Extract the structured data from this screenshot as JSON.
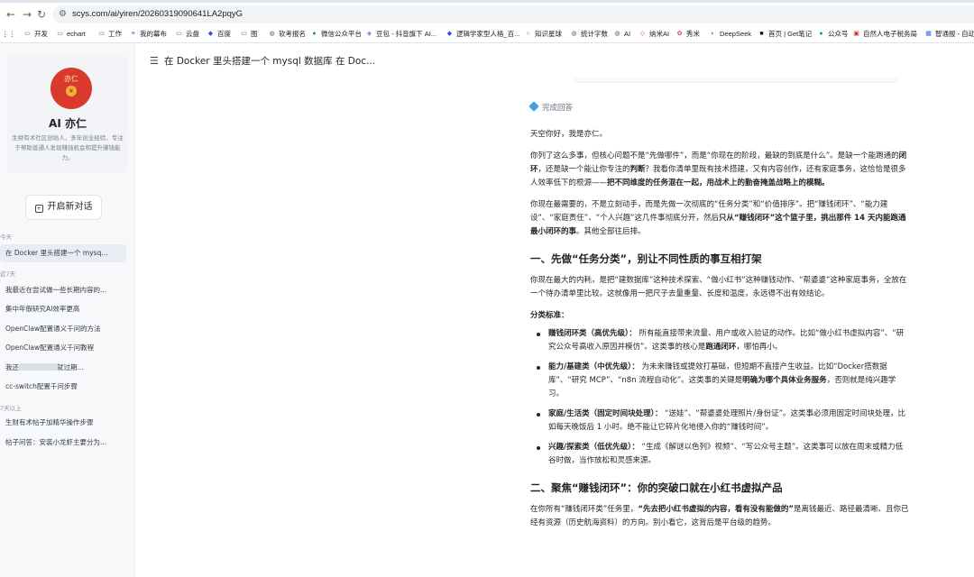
{
  "browser": {
    "url": "scys.com/ai/yiren/20260319090641LA2pqyG",
    "bookmarks": [
      {
        "label": "开发",
        "icon": "folder-icon"
      },
      {
        "label": "echart",
        "icon": "folder-icon"
      },
      {
        "label": "工作",
        "icon": "folder-icon"
      },
      {
        "label": "我的幕布",
        "icon": "mubu-icon"
      },
      {
        "label": "云盘",
        "icon": "folder-icon"
      },
      {
        "label": "百度",
        "icon": "baidu-icon"
      },
      {
        "label": "图",
        "icon": "folder-icon"
      },
      {
        "label": "软考报名",
        "icon": "globe-icon"
      },
      {
        "label": "微信公众平台",
        "icon": "wechat-icon"
      },
      {
        "label": "豆包 - 抖音旗下 AI...",
        "icon": "doubao-icon"
      },
      {
        "label": "逻辑学家型人格_百...",
        "icon": "baidu-icon"
      },
      {
        "label": "知识星球",
        "icon": "zsxq-icon"
      },
      {
        "label": "统计字数",
        "icon": "globe-icon"
      },
      {
        "label": "AI",
        "icon": "globe-icon"
      },
      {
        "label": "纳米AI",
        "icon": "nami-icon"
      },
      {
        "label": "秀米",
        "icon": "xiumi-icon"
      },
      {
        "label": "DeepSeek",
        "icon": "deepseek-icon"
      },
      {
        "label": "首页 | Get笔记",
        "icon": "getnote-icon"
      },
      {
        "label": "公众号",
        "icon": "wechat-icon"
      },
      {
        "label": "自然人电子税务局",
        "icon": "tax-icon"
      },
      {
        "label": "智通报 - 自动发",
        "icon": "doc-icon"
      }
    ]
  },
  "sidebar": {
    "profile": {
      "avatar_text": "亦仁",
      "avatar_coin": "¥",
      "name": "AI 亦仁",
      "description": "生财有术社区创始人，多年创业经验，专注于帮助普通人发现赚钱机会和提升赚钱能力。"
    },
    "new_chat_label": "开启新对话",
    "groups": {
      "today": "今天",
      "last7": "近7天",
      "last30": "7天以上"
    },
    "history": {
      "today": [
        "在 Docker 里头搭建一个 mysq..."
      ],
      "last7": [
        "我最近在尝试做一些长期内容的...",
        "集中年假研究AI效率更高",
        "OpenClaw配置通义千问的方法",
        "OpenClaw配置通义千问教程",
        "cc-switch配置千问步骤"
      ],
      "blurred_item_prefix": "我还",
      "blurred_item_suffix": "就过期...",
      "last30": [
        "生财有术帖子加精华操作步骤",
        "帖子问答：安装小龙虾主要分为..."
      ]
    }
  },
  "main": {
    "title": "在 Docker 里头搭建一个 mysql 数据库 在 Doc...",
    "status": "完成回答",
    "greeting": "天空你好，我是亦仁。",
    "p1": [
      "你列了这么多事，但核心问题不是“先做哪件”，而是“你现在的阶段，最缺的到底是什么”。是缺一个能跑通的",
      "闭环",
      "，还是缺一个能让你专注的",
      "判断",
      "？我看你清单里既有技术搭建，又有内容创作，还有家庭事务，这恰恰是很多人效率低下的根源——",
      "把不同维度的任务混在一起，用战术上的勤奋掩盖战略上的模糊。"
    ],
    "p2": [
      "你现在最需要的，不是立刻动手，而是先做一次彻底的“任务分类”和“价值排序”。把“赚钱闭环”、“能力建设”、“家庭责任”、“个人兴趣”这几件事彻底分开，然后",
      "只从“赚钱闭环”这个篮子里，挑出那件 14 天内能跑通最小闭环的事",
      "。其他全部往后排。"
    ],
    "h1": "一、先做“任务分类”，别让不同性质的事互相打架",
    "p3": "你现在最大的内耗，是把“建数据库”这种技术探索、“做小红书”这种赚钱动作、“帮婆婆”这种家庭事务，全放在一个待办清单里比较。这就像用一把尺子去量重量、长度和温度，永远得不出有效结论。",
    "sub": "分类标准：",
    "bullets": [
      {
        "head": "赚钱闭环类（高优先级）：",
        "text": " 所有能直接带来流量、用户或收入验证的动作。比如“做小红书虚拟内容”、“研究公众号高收入原因并模仿”。这类事的核心是",
        "bold2": "跑通闭环",
        "tail": "，哪怕再小。"
      },
      {
        "head": "能力/基建类（中优先级）：",
        "text": " 为未来赚钱或提效打基础，但短期不直接产生收益。比如“Docker搭数据库”、“研究 MCP”、“n8n 流程自动化”。这类事的关键是",
        "bold2": "明确为哪个具体业务服务",
        "tail": "，否则就是纯兴趣学习。"
      },
      {
        "head": "家庭/生活类（固定时间块处理）：",
        "text": " “送娃”、“帮婆婆处理照片/身份证”。这类事必须用固定时间块处理，比如每天晚饭后 1 小时。绝不能让它碎片化地侵入你的“赚钱时间”。",
        "bold2": "",
        "tail": ""
      },
      {
        "head": "兴趣/探索类（低优先级）：",
        "text": " “生成《解谜以色列》视频”、“写公众号主题”。这类事可以放在周末或精力低谷时做，当作放松和灵感来源。",
        "bold2": "",
        "tail": ""
      }
    ],
    "h2": "二、聚焦“赚钱闭环”：你的突破口就在小红书虚拟产品",
    "p4": [
      "在你所有“赚钱闭环类”任务里，",
      "“先去把小红书虚拟的内容，看有没有能做的”",
      "是离钱最近、路径最清晰、且你已经有资源（历史航海资料）的方向。别小看它，这背后是平台级的趋势。"
    ]
  }
}
